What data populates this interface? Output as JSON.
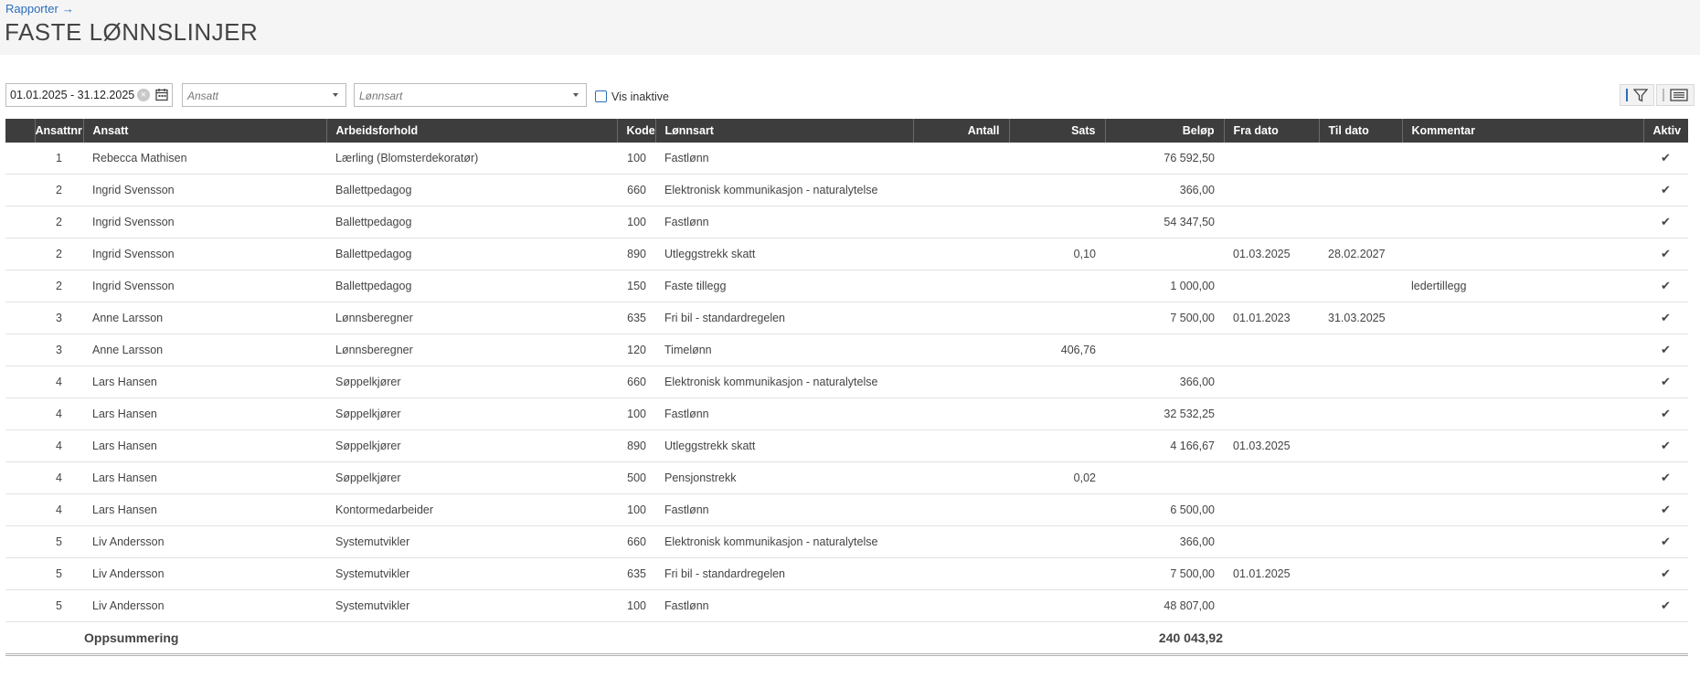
{
  "breadcrumb": {
    "label": "Rapporter",
    "arrow": "→"
  },
  "page_title": "FASTE LØNNSLINJER",
  "filters": {
    "date_range": "01.01.2025 - 31.12.2025",
    "ansatt_placeholder": "Ansatt",
    "lonnsart_placeholder": "Lønnsart",
    "show_inactive_label": "Vis inaktive",
    "show_inactive_checked": false
  },
  "colors": {
    "accent": "#2a6ebb",
    "header_bg": "#3d3d3d"
  },
  "columns": [
    "",
    "Ansattnr",
    "Ansatt",
    "Arbeidsforhold",
    "Kode",
    "Lønnsart",
    "Antall",
    "Sats",
    "Beløp",
    "Fra dato",
    "Til dato",
    "Kommentar",
    "Aktiv"
  ],
  "rows": [
    {
      "nr": "1",
      "ansatt": "Rebecca Mathisen",
      "arbeid": "Lærling (Blomsterdekoratør)",
      "kode": "100",
      "lonnsart": "Fastlønn",
      "antall": "",
      "sats": "",
      "belop": "76 592,50",
      "fra": "",
      "til": "",
      "kommentar": "",
      "aktiv": "✔"
    },
    {
      "nr": "2",
      "ansatt": "Ingrid Svensson",
      "arbeid": "Ballettpedagog",
      "kode": "660",
      "lonnsart": "Elektronisk kommunikasjon - naturalytelse",
      "antall": "",
      "sats": "",
      "belop": "366,00",
      "fra": "",
      "til": "",
      "kommentar": "",
      "aktiv": "✔"
    },
    {
      "nr": "2",
      "ansatt": "Ingrid Svensson",
      "arbeid": "Ballettpedagog",
      "kode": "100",
      "lonnsart": "Fastlønn",
      "antall": "",
      "sats": "",
      "belop": "54 347,50",
      "fra": "",
      "til": "",
      "kommentar": "",
      "aktiv": "✔"
    },
    {
      "nr": "2",
      "ansatt": "Ingrid Svensson",
      "arbeid": "Ballettpedagog",
      "kode": "890",
      "lonnsart": "Utleggstrekk skatt",
      "antall": "",
      "sats": "0,10",
      "belop": "",
      "fra": "01.03.2025",
      "til": "28.02.2027",
      "kommentar": "",
      "aktiv": "✔"
    },
    {
      "nr": "2",
      "ansatt": "Ingrid Svensson",
      "arbeid": "Ballettpedagog",
      "kode": "150",
      "lonnsart": "Faste tillegg",
      "antall": "",
      "sats": "",
      "belop": "1 000,00",
      "fra": "",
      "til": "",
      "kommentar": "ledertillegg",
      "aktiv": "✔"
    },
    {
      "nr": "3",
      "ansatt": "Anne Larsson",
      "arbeid": "Lønnsberegner",
      "kode": "635",
      "lonnsart": "Fri bil - standardregelen",
      "antall": "",
      "sats": "",
      "belop": "7 500,00",
      "fra": "01.01.2023",
      "til": "31.03.2025",
      "kommentar": "",
      "aktiv": "✔"
    },
    {
      "nr": "3",
      "ansatt": "Anne Larsson",
      "arbeid": "Lønnsberegner",
      "kode": "120",
      "lonnsart": "Timelønn",
      "antall": "",
      "sats": "406,76",
      "belop": "",
      "fra": "",
      "til": "",
      "kommentar": "",
      "aktiv": "✔"
    },
    {
      "nr": "4",
      "ansatt": "Lars Hansen",
      "arbeid": "Søppelkjører",
      "kode": "660",
      "lonnsart": "Elektronisk kommunikasjon - naturalytelse",
      "antall": "",
      "sats": "",
      "belop": "366,00",
      "fra": "",
      "til": "",
      "kommentar": "",
      "aktiv": "✔"
    },
    {
      "nr": "4",
      "ansatt": "Lars Hansen",
      "arbeid": "Søppelkjører",
      "kode": "100",
      "lonnsart": "Fastlønn",
      "antall": "",
      "sats": "",
      "belop": "32 532,25",
      "fra": "",
      "til": "",
      "kommentar": "",
      "aktiv": "✔"
    },
    {
      "nr": "4",
      "ansatt": "Lars Hansen",
      "arbeid": "Søppelkjører",
      "kode": "890",
      "lonnsart": "Utleggstrekk skatt",
      "antall": "",
      "sats": "",
      "belop": "4 166,67",
      "fra": "01.03.2025",
      "til": "",
      "kommentar": "",
      "aktiv": "✔"
    },
    {
      "nr": "4",
      "ansatt": "Lars Hansen",
      "arbeid": "Søppelkjører",
      "kode": "500",
      "lonnsart": "Pensjonstrekk",
      "antall": "",
      "sats": "0,02",
      "belop": "",
      "fra": "",
      "til": "",
      "kommentar": "",
      "aktiv": "✔"
    },
    {
      "nr": "4",
      "ansatt": "Lars Hansen",
      "arbeid": "Kontormedarbeider",
      "kode": "100",
      "lonnsart": "Fastlønn",
      "antall": "",
      "sats": "",
      "belop": "6 500,00",
      "fra": "",
      "til": "",
      "kommentar": "",
      "aktiv": "✔"
    },
    {
      "nr": "5",
      "ansatt": "Liv Andersson",
      "arbeid": "Systemutvikler",
      "kode": "660",
      "lonnsart": "Elektronisk kommunikasjon - naturalytelse",
      "antall": "",
      "sats": "",
      "belop": "366,00",
      "fra": "",
      "til": "",
      "kommentar": "",
      "aktiv": "✔"
    },
    {
      "nr": "5",
      "ansatt": "Liv Andersson",
      "arbeid": "Systemutvikler",
      "kode": "635",
      "lonnsart": "Fri bil - standardregelen",
      "antall": "",
      "sats": "",
      "belop": "7 500,00",
      "fra": "01.01.2025",
      "til": "",
      "kommentar": "",
      "aktiv": "✔"
    },
    {
      "nr": "5",
      "ansatt": "Liv Andersson",
      "arbeid": "Systemutvikler",
      "kode": "100",
      "lonnsart": "Fastlønn",
      "antall": "",
      "sats": "",
      "belop": "48 807,00",
      "fra": "",
      "til": "",
      "kommentar": "",
      "aktiv": "✔"
    }
  ],
  "summary": {
    "label": "Oppsummering",
    "total": "240 043,92"
  }
}
